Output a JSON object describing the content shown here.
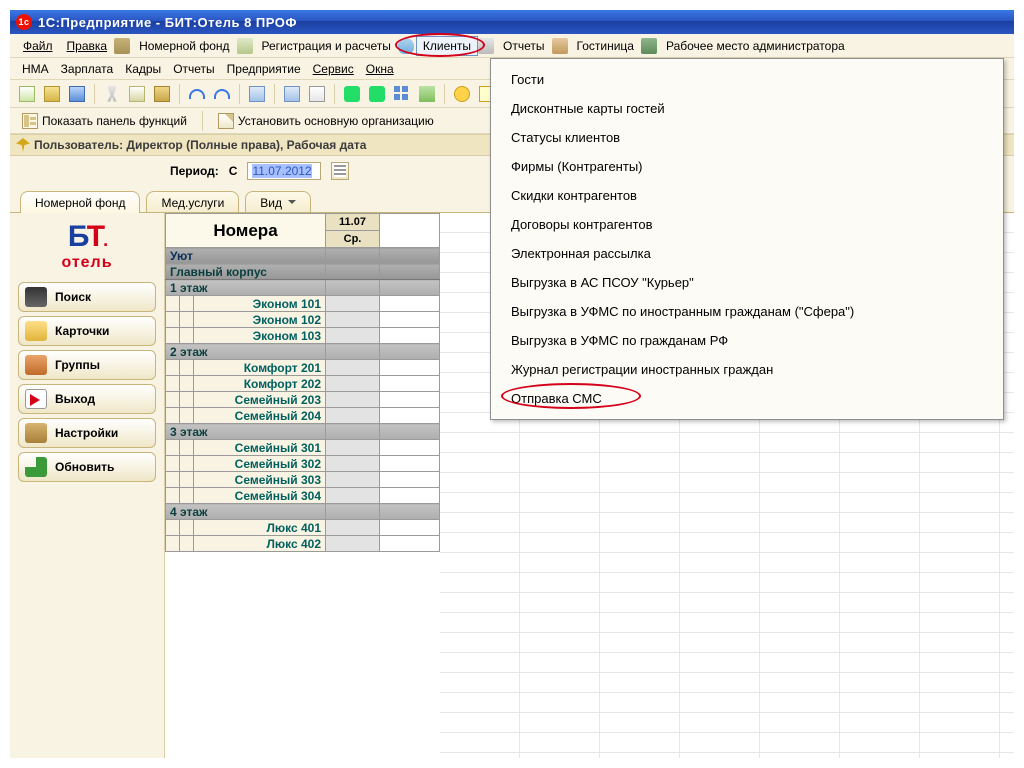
{
  "title": "1С:Предприятие - БИТ:Отель 8 ПРОФ",
  "menubar1": {
    "file": "Файл",
    "edit": "Правка",
    "rooms": "Номерной фонд",
    "reg": "Регистрация и расчеты",
    "clients": "Клиенты",
    "reports": "Отчеты",
    "hotel": "Гостиница",
    "admin": "Рабочее место администратора"
  },
  "menubar2": {
    "nma": "НМА",
    "salary": "Зарплата",
    "hr": "Кадры",
    "reports": "Отчеты",
    "enterprise": "Предприятие",
    "service": "Сервис",
    "windows": "Окна"
  },
  "toolbar2": {
    "show_panel": "Показать панель функций",
    "set_org": "Установить основную организацию"
  },
  "userrow": "Пользователь: Директор (Полные права), Рабочая дата",
  "period": {
    "label": "Период:",
    "from": "С",
    "value": "11.07.2012"
  },
  "tabs": {
    "rooms": "Номерной фонд",
    "med": "Мед.услуги",
    "view": "Вид"
  },
  "sidebar": {
    "logo_top": "БТ",
    "logo_text": "отель",
    "search": "Поиск",
    "cards": "Карточки",
    "groups": "Группы",
    "exit": "Выход",
    "settings": "Настройки",
    "refresh": "Обновить"
  },
  "grid": {
    "header_rooms": "Номера",
    "date": "11.07",
    "dow": "Ср.",
    "rows": [
      {
        "type": "hotel",
        "label": "Уют"
      },
      {
        "type": "group",
        "label": "Главный корпус"
      },
      {
        "type": "floor",
        "label": "1 этаж"
      },
      {
        "type": "room",
        "label": "Эконом 101"
      },
      {
        "type": "room",
        "label": "Эконом 102"
      },
      {
        "type": "room",
        "label": "Эконом 103"
      },
      {
        "type": "floor",
        "label": "2 этаж"
      },
      {
        "type": "room",
        "label": "Комфорт 201"
      },
      {
        "type": "room",
        "label": "Комфорт 202"
      },
      {
        "type": "room",
        "label": "Семейный 203"
      },
      {
        "type": "room",
        "label": "Семейный 204"
      },
      {
        "type": "floor",
        "label": "3 этаж"
      },
      {
        "type": "room",
        "label": "Семейный 301"
      },
      {
        "type": "room",
        "label": "Семейный 302"
      },
      {
        "type": "room",
        "label": "Семейный 303"
      },
      {
        "type": "room",
        "label": "Семейный 304"
      },
      {
        "type": "floor",
        "label": "4 этаж"
      },
      {
        "type": "room",
        "label": "Люкс 401"
      },
      {
        "type": "room",
        "label": "Люкс 402"
      }
    ]
  },
  "dropdown": {
    "items": [
      "Гости",
      "Дисконтные карты гостей",
      "Статусы клиентов",
      "Фирмы (Контрагенты)",
      "Скидки контрагентов",
      "Договоры контрагентов",
      "Электронная рассылка",
      "Выгрузка в АС ПСОУ \"Курьер\"",
      "Выгрузка в УФМС по иностранным гражданам (\"Сфера\")",
      "Выгрузка в УФМС по гражданам РФ",
      "Журнал регистрации иностранных граждан",
      "Отправка СМС"
    ]
  }
}
